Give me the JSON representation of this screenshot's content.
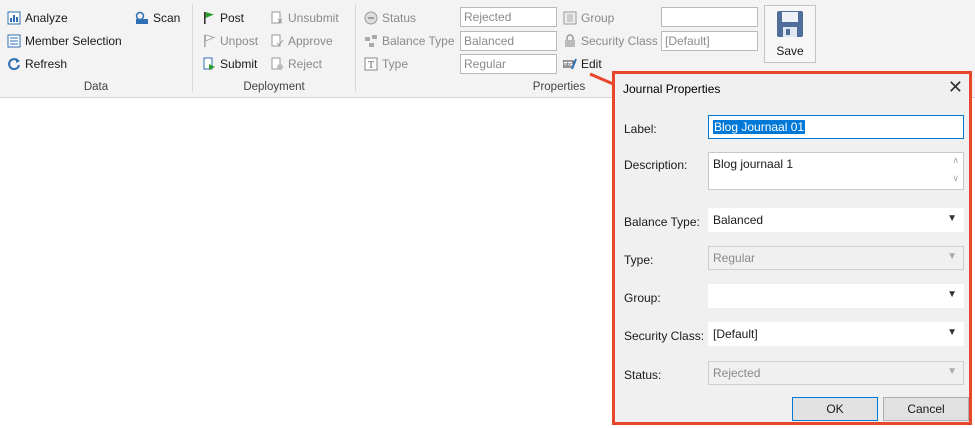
{
  "ribbon": {
    "data_group": {
      "label": "Data",
      "analyze": "Analyze",
      "scan": "Scan",
      "member_selection": "Member Selection",
      "refresh": "Refresh"
    },
    "deployment_group": {
      "label": "Deployment",
      "post": "Post",
      "unsubmit": "Unsubmit",
      "unpost": "Unpost",
      "approve": "Approve",
      "submit": "Submit",
      "reject": "Reject"
    },
    "properties_group": {
      "label": "Properties",
      "status_label": "Status",
      "status_value": "Rejected",
      "balance_type_label": "Balance Type",
      "balance_type_value": "Balanced",
      "type_label": "Type",
      "type_value": "Regular",
      "group_label": "Group",
      "group_value": "",
      "security_class_label": "Security Class",
      "security_class_value": "[Default]",
      "edit": "Edit"
    },
    "save": "Save"
  },
  "dialog": {
    "title": "Journal Properties",
    "close": "✕",
    "label_label": "Label:",
    "label_value": "Blog Journaal 01",
    "description_label": "Description:",
    "description_value": "Blog journaal 1",
    "balance_type_label": "Balance Type:",
    "balance_type_value": "Balanced",
    "type_label": "Type:",
    "type_value": "Regular",
    "group_label": "Group:",
    "group_value": "",
    "security_class_label": "Security Class:",
    "security_class_value": "[Default]",
    "status_label": "Status:",
    "status_value": "Rejected",
    "ok": "OK",
    "cancel": "Cancel"
  },
  "colors": {
    "highlight": "#e8462a",
    "selection": "#0078d7",
    "post_flag": "#2a9d2a",
    "icon_blue": "#2f6fb3"
  }
}
